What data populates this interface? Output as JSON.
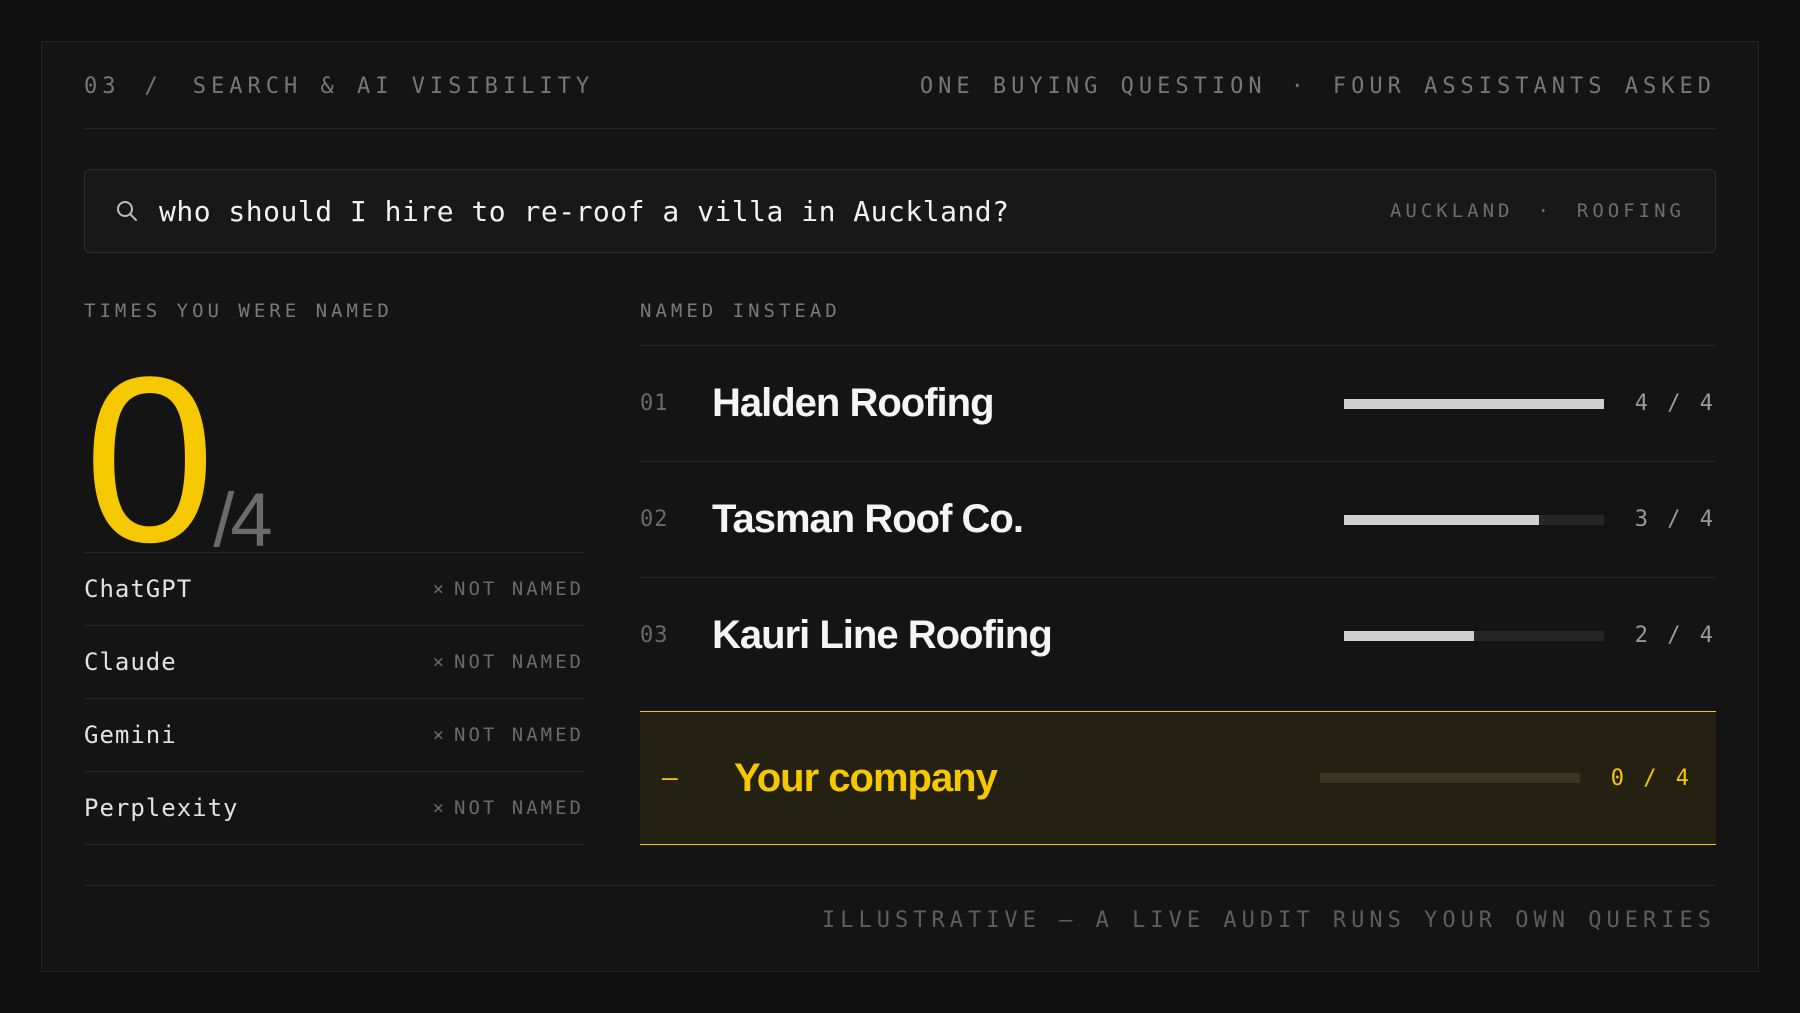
{
  "header": {
    "section_number": "03",
    "separator": "/",
    "section_title": "SEARCH & AI VISIBILITY",
    "right_left": "ONE BUYING QUESTION",
    "right_dot": "·",
    "right_right": "FOUR ASSISTANTS ASKED"
  },
  "search": {
    "icon": "search-icon",
    "query": "who should I hire to re-roof a villa in Auckland?",
    "tag_location": "AUCKLAND",
    "tag_dot": "·",
    "tag_category": "ROOFING"
  },
  "score": {
    "label": "TIMES YOU WERE NAMED",
    "value": "0",
    "total": "/4"
  },
  "assistants": [
    {
      "name": "ChatGPT",
      "mark": "×",
      "status": "NOT NAMED"
    },
    {
      "name": "Claude",
      "mark": "×",
      "status": "NOT NAMED"
    },
    {
      "name": "Gemini",
      "mark": "×",
      "status": "NOT NAMED"
    },
    {
      "name": "Perplexity",
      "mark": "×",
      "status": "NOT NAMED"
    }
  ],
  "competitors": {
    "label": "NAMED INSTEAD",
    "rows": [
      {
        "rank": "01",
        "name": "Halden Roofing",
        "fraction": 1.0,
        "count": "4 / 4"
      },
      {
        "rank": "02",
        "name": "Tasman Roof Co.",
        "fraction": 0.75,
        "count": "3 / 4"
      },
      {
        "rank": "03",
        "name": "Kauri Line Roofing",
        "fraction": 0.5,
        "count": "2 / 4"
      }
    ]
  },
  "you": {
    "rank": "–",
    "name": "Your company",
    "fraction": 0,
    "count": "0 / 4"
  },
  "footer": {
    "note": "ILLUSTRATIVE — A LIVE AUDIT RUNS YOUR OWN QUERIES"
  },
  "colors": {
    "accent": "#f5c800",
    "background": "#141414",
    "bar_fill": "#cfcfcf"
  }
}
